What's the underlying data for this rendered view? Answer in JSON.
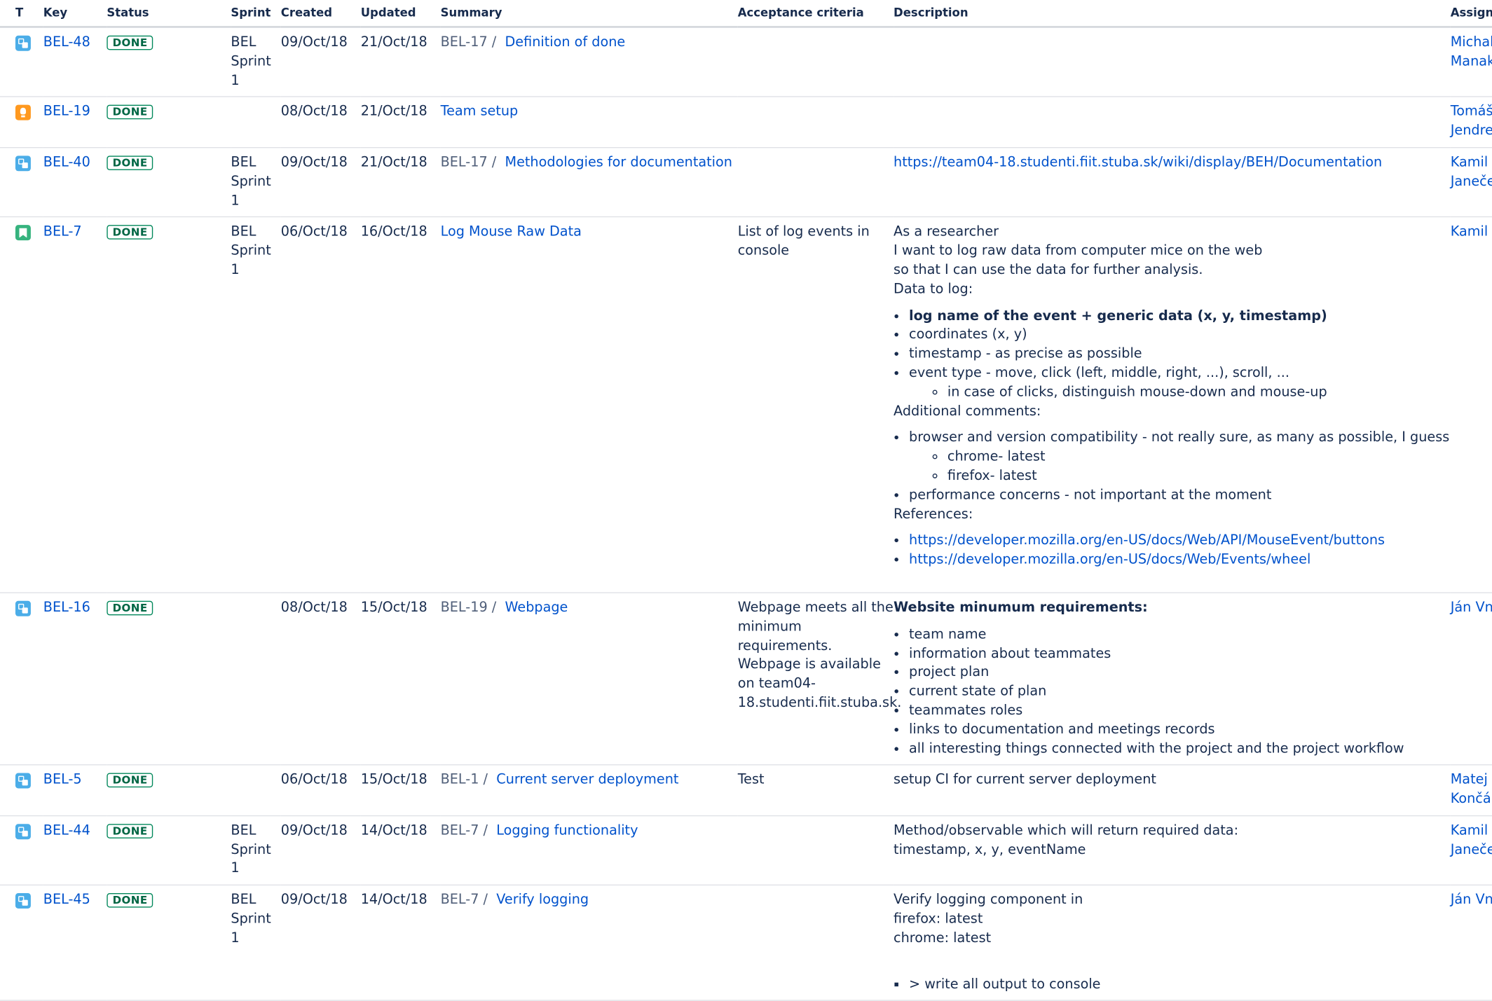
{
  "columns": {
    "t": "T",
    "key": "Key",
    "status": "Status",
    "sprint": "Sprint",
    "created": "Created",
    "updated": "Updated",
    "summary": "Summary",
    "acceptance": "Acceptance criteria",
    "description": "Description",
    "assignee": "Assignee"
  },
  "rows": [
    {
      "type_icon": "subtask-icon",
      "key": "BEL-48",
      "status": "DONE",
      "sprint": [
        "BEL",
        "Sprint",
        "1"
      ],
      "created": "09/Oct/18",
      "updated": "21/Oct/18",
      "parent": "BEL-17 /",
      "summary": "Definition of done",
      "acceptance": "",
      "assignee": [
        "Michal",
        "Manak"
      ]
    },
    {
      "type_icon": "improvement-icon",
      "key": "BEL-19",
      "status": "DONE",
      "created": "08/Oct/18",
      "updated": "21/Oct/18",
      "summary": "Team setup",
      "assignee": [
        "Tomáš",
        "Jendrej"
      ]
    },
    {
      "type_icon": "subtask-icon",
      "key": "BEL-40",
      "status": "DONE",
      "sprint": [
        "BEL",
        "Sprint",
        "1"
      ],
      "created": "09/Oct/18",
      "updated": "21/Oct/18",
      "parent": "BEL-17 /",
      "summary": "Methodologies for documentation",
      "description_link": "https://team04-18.studenti.fiit.stuba.sk/wiki/display/BEH/Documentation",
      "assignee": [
        "Kamil",
        "Janeče"
      ]
    },
    {
      "type_icon": "story-icon",
      "key": "BEL-7",
      "status": "DONE",
      "sprint": [
        "BEL",
        "Sprint",
        "1"
      ],
      "created": "06/Oct/18",
      "updated": "16/Oct/18",
      "summary": "Log Mouse Raw Data",
      "acceptance": [
        "List of log events in",
        "console"
      ],
      "description": {
        "intro": [
          "As a researcher",
          "I want to log raw data from computer mice on the web",
          "so that I can use the data for further analysis.",
          "Data to log:"
        ],
        "data_items": [
          "log name of the event + generic data (x, y, timestamp)",
          "coordinates (x, y)",
          "timestamp - as precise as possible",
          "event type - move, click (left, middle, right, ...), scroll, ..."
        ],
        "data_subitem": "in case of clicks, distinguish mouse-down and mouse-up",
        "additional_heading": "Additional comments:",
        "additional_items": [
          "browser and version compatibility - not really sure, as many as possible, I guess",
          "performance concerns - not important at the moment"
        ],
        "browser_subitems": [
          "chrome- latest",
          "firefox- latest"
        ],
        "references_heading": "References:",
        "references": [
          "https://developer.mozilla.org/en-US/docs/Web/API/MouseEvent/buttons",
          "https://developer.mozilla.org/en-US/docs/Web/Events/wheel"
        ]
      },
      "assignee": [
        "Kamil E"
      ]
    },
    {
      "type_icon": "subtask-icon",
      "key": "BEL-16",
      "status": "DONE",
      "created": "08/Oct/18",
      "updated": "15/Oct/18",
      "parent": "BEL-19 /",
      "summary": "Webpage",
      "acceptance": [
        "Webpage meets all the",
        "minimum",
        "requirements.",
        "Webpage is available",
        "on team04-",
        "18.studenti.fiit.stuba.sk."
      ],
      "description": {
        "heading": "Website minumum requirements:",
        "items": [
          "team name",
          "information about teammates",
          "project plan",
          "current state of plan",
          "teammates roles",
          "links to documentation and meetings records",
          "all interesting things connected with the project and the project workflow"
        ]
      },
      "assignee": [
        "Ján Vne"
      ]
    },
    {
      "type_icon": "subtask-icon",
      "key": "BEL-5",
      "status": "DONE",
      "created": "06/Oct/18",
      "updated": "15/Oct/18",
      "parent": "BEL-1 /",
      "summary": "Current server deployment",
      "acceptance": [
        "Test"
      ],
      "description_text": "setup CI for current server deployment",
      "assignee": [
        "Matej",
        "Končál"
      ]
    },
    {
      "type_icon": "subtask-icon",
      "key": "BEL-44",
      "status": "DONE",
      "sprint": [
        "BEL",
        "Sprint",
        "1"
      ],
      "created": "09/Oct/18",
      "updated": "14/Oct/18",
      "parent": "BEL-7 /",
      "summary": "Logging functionality",
      "description_lines": [
        "Method/observable which will return required data:",
        "timestamp, x, y, eventName"
      ],
      "assignee": [
        "Kamil",
        "Janeče"
      ]
    },
    {
      "type_icon": "subtask-icon",
      "key": "BEL-45",
      "status": "DONE",
      "sprint": [
        "BEL",
        "Sprint",
        "1"
      ],
      "created": "09/Oct/18",
      "updated": "14/Oct/18",
      "parent": "BEL-7 /",
      "summary": "Verify logging",
      "description_lines": [
        "Verify logging component in",
        "firefox: latest",
        "chrome: latest"
      ],
      "description_square_item": "> write all output to console",
      "assignee": [
        "Ján Vne"
      ]
    }
  ]
}
